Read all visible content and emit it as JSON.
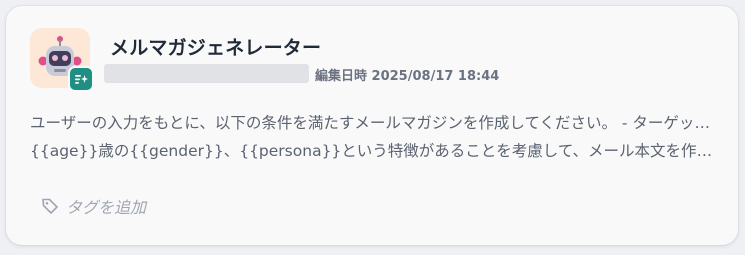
{
  "card": {
    "title": "メルマガジェネレーター",
    "edited_label": "編集日時",
    "edited_at": "2025/08/17 18:44",
    "description_lines": [
      "ユーザーの入力をもとに、以下の条件を満たすメールマガジンを作成してください。 - ターゲット像は",
      "{{age}}歳の{{gender}}、{{persona}}という特徴があることを考慮して、メール本文を作成してくだ..."
    ],
    "tag_add_label": "タグを追加",
    "avatar_icon": "robot-icon",
    "badge_icon": "generate-icon",
    "tag_icon": "tag-icon"
  },
  "colors": {
    "badge": "#1e8f82",
    "avatar_bg": "#fde7d6",
    "robot_accent": "#e04f8a"
  }
}
